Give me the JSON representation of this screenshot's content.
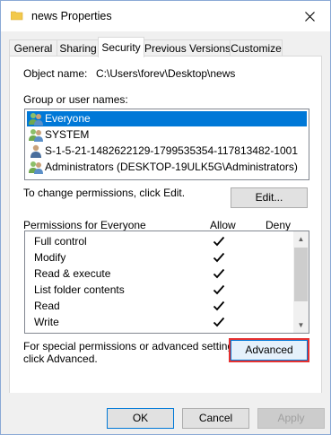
{
  "window": {
    "title": "news Properties"
  },
  "tabs": [
    "General",
    "Sharing",
    "Security",
    "Previous Versions",
    "Customize"
  ],
  "active_tab": "Security",
  "object": {
    "label": "Object name:",
    "value": "C:\\Users\\forev\\Desktop\\news"
  },
  "groups": {
    "label": "Group or user names:",
    "items": [
      "Everyone",
      "SYSTEM",
      "S-1-5-21-1482622129-1799535354-117813482-1001",
      "Administrators (DESKTOP-19ULK5G\\Administrators)"
    ]
  },
  "change_text": "To change permissions, click Edit.",
  "edit_label": "Edit...",
  "permissions": {
    "header": "Permissions for Everyone",
    "allow_label": "Allow",
    "deny_label": "Deny",
    "rows": [
      {
        "name": "Full control",
        "allow": true
      },
      {
        "name": "Modify",
        "allow": true
      },
      {
        "name": "Read & execute",
        "allow": true
      },
      {
        "name": "List folder contents",
        "allow": true
      },
      {
        "name": "Read",
        "allow": true
      },
      {
        "name": "Write",
        "allow": true
      }
    ]
  },
  "special_text_1": "For special permissions or advanced settings,",
  "special_text_2": "click Advanced.",
  "advanced_label": "Advanced",
  "buttons": {
    "ok": "OK",
    "cancel": "Cancel",
    "apply": "Apply"
  },
  "colors": {
    "selection": "#0078d7",
    "highlight_border": "#e53030"
  },
  "icons": {
    "folder": "folder-icon",
    "close": "close-icon",
    "users": "users-icon",
    "user": "user-icon",
    "check": "check-icon"
  }
}
